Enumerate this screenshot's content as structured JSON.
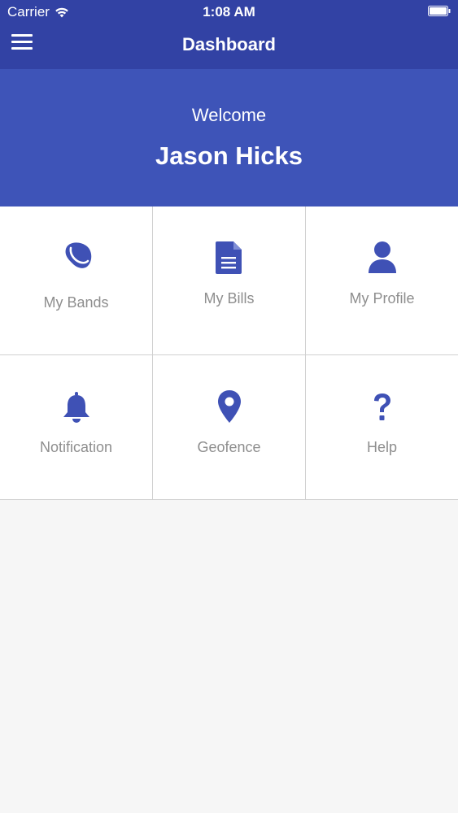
{
  "status_bar": {
    "carrier": "Carrier",
    "time": "1:08 AM"
  },
  "header": {
    "title": "Dashboard",
    "menu_icon": "hamburger-menu-icon"
  },
  "welcome": {
    "greeting": "Welcome",
    "user_name": "Jason Hicks"
  },
  "tiles": [
    {
      "label": "My Bands",
      "icon": "band-icon"
    },
    {
      "label": "My Bills",
      "icon": "document-icon"
    },
    {
      "label": "My Profile",
      "icon": "user-icon"
    },
    {
      "label": "Notification",
      "icon": "bell-icon"
    },
    {
      "label": "Geofence",
      "icon": "map-pin-icon"
    },
    {
      "label": "Help",
      "icon": "question-mark-icon"
    }
  ],
  "colors": {
    "header_blue": "#3242a4",
    "welcome_blue": "#3e54b8",
    "icon_blue": "#3f51b5",
    "label_gray": "#8e8e8e"
  }
}
